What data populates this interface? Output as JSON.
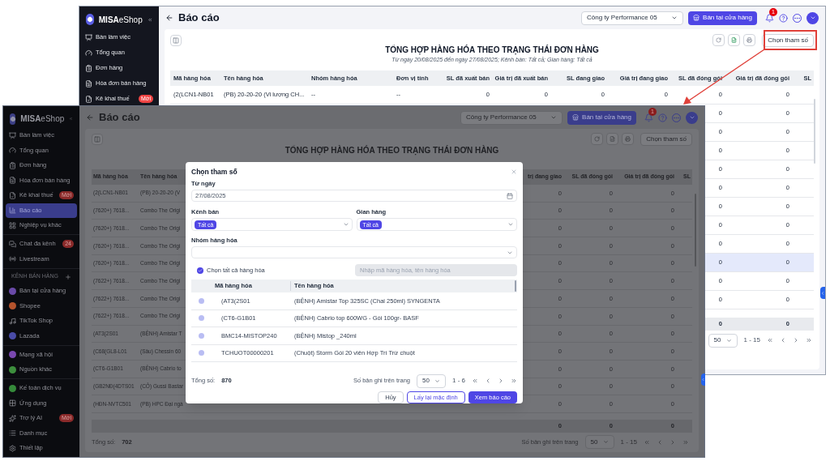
{
  "back_window": {
    "sidebar": {
      "logo": "**MISA**eShop",
      "items": [
        {
          "label": "Bàn làm việc",
          "selected": false
        },
        {
          "label": "Tổng quan",
          "selected": false
        },
        {
          "label": "Đơn hàng",
          "selected": false
        },
        {
          "label": "Hóa đơn bán hàng",
          "selected": false
        },
        {
          "label": "Kê khai thuế",
          "badge": "Mới",
          "selected": false
        }
      ]
    },
    "header": {
      "title": "Báo cáo",
      "company": "Công ty Performance 05",
      "store_button": "Bán tại cửa hàng",
      "notification_count": "1"
    },
    "report": {
      "action_button": "Chọn tham số",
      "title": "TỔNG HỢP HÀNG HÓA THEO TRẠNG THÁI ĐƠN HÀNG",
      "subtitle": "Từ ngày 20/08/2025 đến ngày 27/08/2025; Kênh bán: Tất cả; Gian hàng: Tất cả"
    },
    "table": {
      "columns": [
        "Mã hàng hóa",
        "Tên hàng hóa",
        "Nhóm hàng hóa",
        "Đơn vị tính",
        "SL đã xuất bán",
        "Giá trị đã xuất bán",
        "SL đang giao",
        "Giá trị đang giao",
        "SL đã đóng gói",
        "Giá trị đã đóng gói",
        "SL"
      ],
      "rows": [
        {
          "cells": [
            "(2(LCN1-NB01",
            "(PB) 20-20-20 (Vi lượng CH...",
            "--",
            "--",
            "0",
            "0",
            "0",
            "0",
            "0",
            "0"
          ],
          "selected": false
        },
        {
          "cells": [
            "0",
            "0"
          ],
          "selected": false
        },
        {
          "cells": [
            "0",
            "0"
          ],
          "selected": false
        },
        {
          "cells": [
            "0",
            "0"
          ],
          "selected": false
        },
        {
          "cells": [
            "0",
            "0"
          ],
          "selected": false
        },
        {
          "cells": [
            "0",
            "0"
          ],
          "selected": false
        },
        {
          "cells": [
            "0",
            "0"
          ],
          "selected": false
        },
        {
          "cells": [
            "0",
            "0"
          ],
          "selected": false
        },
        {
          "cells": [
            "0",
            "0"
          ],
          "selected": false
        },
        {
          "cells": [
            "0",
            "0"
          ],
          "selected": true
        },
        {
          "cells": [
            "0",
            "0"
          ],
          "selected": false
        },
        {
          "cells": [
            "0",
            "0"
          ],
          "selected": false
        }
      ],
      "total": [
        "0",
        "0"
      ]
    },
    "pagination": {
      "page_size": "50",
      "range": "1 - 15"
    }
  },
  "front_window": {
    "sidebar": {
      "logo": "**MISA**eShop",
      "groups": [
        {
          "items": [
            {
              "label": "Bàn làm việc",
              "selected": false
            },
            {
              "label": "Tổng quan",
              "selected": false
            },
            {
              "label": "Đơn hàng",
              "selected": false
            },
            {
              "label": "Hóa đơn bán hàng",
              "selected": false
            },
            {
              "label": "Kê khai thuế",
              "badge": "Mới",
              "selected": false
            },
            {
              "label": "Báo cáo",
              "selected": true
            },
            {
              "label": "Nghiệp vụ khác",
              "selected": false
            }
          ]
        },
        {
          "items": [
            {
              "label": "Chat đa kênh",
              "badge": "24",
              "selected": false
            },
            {
              "label": "Livestream",
              "selected": false
            }
          ]
        },
        {
          "heading": "KÊNH BÁN HÀNG",
          "items": [
            {
              "label": "Bán tại cửa hàng",
              "color": "#6a4aa8",
              "selected": false
            },
            {
              "label": "Shopee",
              "color": "#b4532c",
              "selected": false
            },
            {
              "label": "TikTok Shop",
              "selected": false
            },
            {
              "label": "Lazada",
              "color": "#4a4ca8",
              "selected": false
            }
          ]
        },
        {
          "items": [
            {
              "label": "Mạng xã hội",
              "color": "#7a48b0",
              "selected": false
            },
            {
              "label": "Nguồn khác",
              "color": "#3d8f3d",
              "selected": false
            }
          ]
        },
        {
          "items": [
            {
              "label": "Kế toán dịch vụ",
              "color": "#358a3a",
              "selected": false
            },
            {
              "label": "Ứng dụng",
              "selected": false
            },
            {
              "label": "Trợ lý AI",
              "badge": "Mới",
              "selected": false
            },
            {
              "label": "Danh mục",
              "selected": false
            },
            {
              "label": "Thiết lập",
              "selected": false
            }
          ]
        }
      ]
    },
    "header": {
      "title": "Báo cáo",
      "company": "Công ty Performance 05",
      "store_button": "Bán tại cửa hàng",
      "notification_count": "1"
    },
    "report": {
      "action_button": "Chọn tham số",
      "title": "TỔNG HỢP HÀNG HÓA THEO TRẠNG THÁI ĐƠN HÀNG"
    },
    "table": {
      "columns": [
        "Mã hàng hóa",
        "Tên hàng hóa",
        "trị đang giao",
        "SL đã đóng gói",
        "Giá trị đã đóng gói",
        "SL"
      ],
      "rows": [
        {
          "cells": [
            "(2(LCN1-NB01",
            "(PB) 20-20-20 (V",
            "0",
            "0",
            "0"
          ]
        },
        {
          "cells": [
            "(7620+) 7618...",
            "Combo The Origi",
            "0",
            "0",
            "0"
          ]
        },
        {
          "cells": [
            "(7620+) 7618...",
            "Combo The Origi",
            "0",
            "0",
            "0"
          ]
        },
        {
          "cells": [
            "(7620+) 7618...",
            "Combo The Origi",
            "0",
            "0",
            "0"
          ]
        },
        {
          "cells": [
            "(7620+) 7618...",
            "Combo The Origi",
            "0",
            "0",
            "0"
          ]
        },
        {
          "cells": [
            "(7622+) 7618...",
            "Combo The Origi",
            "0",
            "0",
            "0"
          ]
        },
        {
          "cells": [
            "(7622+) 7618...",
            "Combo The Origi",
            "0",
            "0",
            "0"
          ]
        },
        {
          "cells": [
            "(7622+) 7618...",
            "Combo The Origi",
            "0",
            "0",
            "0"
          ]
        },
        {
          "cells": [
            "(AT3(2S01",
            "(BỆNH) Amistar T",
            "0",
            "0",
            "0"
          ]
        },
        {
          "cells": [
            "(C68(GL8-L01",
            "(Sâu) Chessin 60",
            "0",
            "0",
            "0"
          ]
        },
        {
          "cells": [
            "(CT6-G1B01",
            "(BỆNH) Cabrio to",
            "0",
            "0",
            "0"
          ]
        },
        {
          "cells": [
            "(GB2NĐ(4DTS01",
            "(CỎ) Gussi Bastar",
            "0",
            "0",
            "0"
          ]
        },
        {
          "cells": [
            "(HĐN-NVTC501",
            "(PB) HPC Đại ngà",
            "0",
            "0",
            "0"
          ]
        }
      ],
      "total": [
        "0",
        "0",
        "0"
      ]
    },
    "footer": {
      "total_label": "Tổng số:",
      "total_value": "702",
      "page_size_label": "Số bản ghi trên trang",
      "page_size": "50",
      "range": "1 - 15"
    }
  },
  "dialog": {
    "title": "Chọn tham số",
    "from_date": {
      "label": "Từ ngày",
      "value": "27/08/2025"
    },
    "channel": {
      "label": "Kênh bán",
      "tags": [
        "Tất cả"
      ]
    },
    "store": {
      "label": "Gian hàng",
      "tags": [
        "Tất cả"
      ]
    },
    "product_group": {
      "label": "Nhóm hàng hóa"
    },
    "select_all": {
      "label": "Chọn tất cả hàng hóa",
      "checked": true
    },
    "search": {
      "placeholder": "Nhập mã hàng hóa, tên hàng hóa",
      "disabled": true
    },
    "table": {
      "columns": [
        "Mã hàng hóa",
        "Tên hàng hóa"
      ],
      "rows": [
        {
          "code": "(AT3(2S01",
          "name": "(BỆNH) Amistar Top 325SC (Chai 250ml) SYNGENTA",
          "disabled": true
        },
        {
          "code": "(CT6-G1B01",
          "name": "(BỆNH) Cabrio top 600WG - Gói 100gr- BASF",
          "disabled": true
        },
        {
          "code": "BMC14-MISTOP240",
          "name": "(BỆNH) Mistop _240ml",
          "disabled": true
        },
        {
          "code": "TCHUOT00000201",
          "name": "(Chuột) Storm Gói 20 viên  Hợp Trí Trừ chuột",
          "disabled": true
        }
      ]
    },
    "footer": {
      "total_label": "Tổng số:",
      "total_value": "870",
      "page_size_label": "Số bản ghi trên trang",
      "page_size": "50",
      "range": "1 - 6"
    },
    "buttons": [
      {
        "label": "Hủy",
        "kind": "secondary"
      },
      {
        "label": "Lấy lại mặc định",
        "kind": "outline"
      },
      {
        "label": "Xem báo cáo",
        "kind": "primary"
      }
    ]
  }
}
